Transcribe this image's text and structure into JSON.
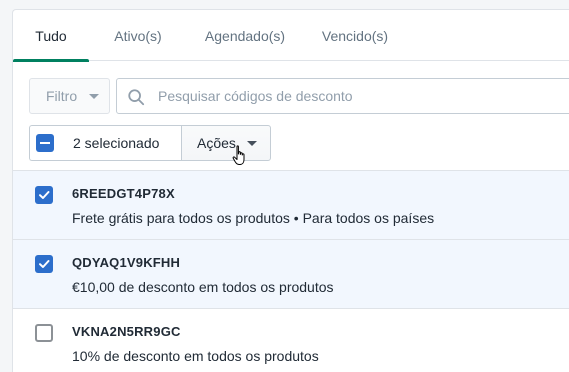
{
  "tabs": [
    {
      "label": "Tudo"
    },
    {
      "label": "Ativo(s)"
    },
    {
      "label": "Agendado(s)"
    },
    {
      "label": "Vencido(s)"
    }
  ],
  "filter": {
    "label": "Filtro"
  },
  "search": {
    "placeholder": "Pesquisar códigos de desconto"
  },
  "bulk": {
    "selected_label": "2 selecionado",
    "actions_label": "Ações"
  },
  "discounts": [
    {
      "code": "6REEDGT4P78X",
      "description": "Frete grátis para todos os produtos • Para todos os países",
      "checked": true
    },
    {
      "code": "QDYAQ1V9KFHH",
      "description": "€10,00 de desconto em todos os produtos",
      "checked": true
    },
    {
      "code": "VKNA2N5RR9GC",
      "description": "10% de desconto em todos os produtos",
      "checked": false
    }
  ],
  "colors": {
    "accent": "#008060",
    "checkbox": "#2c6ecb",
    "selected_row": "#f2f7fe"
  },
  "icons": {
    "search": "search-icon",
    "cursor": "hand-pointer-icon"
  }
}
